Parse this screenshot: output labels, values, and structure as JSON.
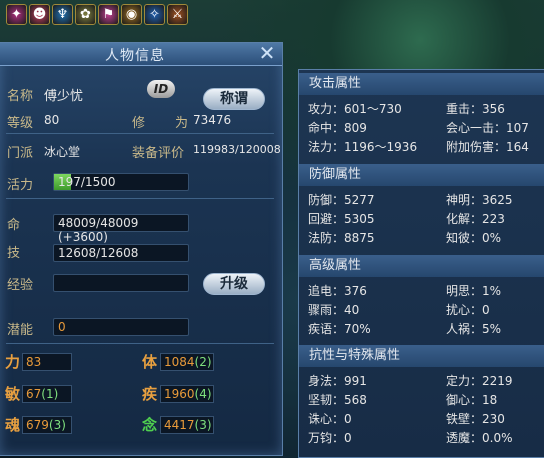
{
  "buffs": [
    {
      "icon": "buff-icon-1",
      "glyph": "✦",
      "color": "#b03080"
    },
    {
      "icon": "buff-icon-2",
      "glyph": "☻",
      "color": "#c84060"
    },
    {
      "icon": "buff-icon-3",
      "glyph": "♆",
      "color": "#2070b0"
    },
    {
      "icon": "buff-icon-4",
      "glyph": "✿",
      "color": "#808040"
    },
    {
      "icon": "buff-icon-5",
      "glyph": "⚑",
      "color": "#c04090"
    },
    {
      "icon": "buff-icon-6",
      "glyph": "◉",
      "color": "#a07020"
    },
    {
      "icon": "buff-icon-7",
      "glyph": "✧",
      "color": "#2060b0"
    },
    {
      "icon": "buff-icon-8",
      "glyph": "⚔",
      "color": "#a05020"
    }
  ],
  "left": {
    "title": "人物信息",
    "name_label": "名称",
    "name": "傅少忧",
    "id_button": "ID",
    "title_button": "称谓",
    "level_label": "等级",
    "level": "80",
    "cult_label1": "修",
    "cult_label2": "为",
    "cultivation": "73476",
    "sect_label": "门派",
    "sect": "冰心堂",
    "equip_label": "装备评价",
    "equip_score": "119983/120008",
    "vitality_label": "活力",
    "vitality": "197/1500",
    "vitality_fill": 0.13,
    "hp_label": "命",
    "hp": "48009/48009 (+3600)",
    "skill_label": "技",
    "skill": "12608/12608",
    "exp_label": "经验",
    "exp": "",
    "levelup_button": "升级",
    "potential_label": "潜能",
    "potential": "0",
    "stats": {
      "li_label": "力",
      "li": "83",
      "li_bonus": "",
      "ti_label": "体",
      "ti": "1084",
      "ti_bonus": "(2)",
      "min_label": "敏",
      "min": "67",
      "min_bonus": "(1)",
      "ji_label": "疾",
      "ji": "1960",
      "ji_bonus": "(4)",
      "hun_label": "魂",
      "hun": "679",
      "hun_bonus": "(3)",
      "nian_label": "念",
      "nian": "4417",
      "nian_bonus": "(3)"
    }
  },
  "right": {
    "attack_title": "攻击属性",
    "attack": [
      [
        "攻力：601～730",
        "重击：356"
      ],
      [
        "命中：809",
        "会心一击：107"
      ],
      [
        "法力：1196～1936",
        "附加伤害：164"
      ]
    ],
    "defense_title": "防御属性",
    "defense": [
      [
        "防御：5277",
        "神明：3625"
      ],
      [
        "回避：5305",
        "化解：223"
      ],
      [
        "法防：8875",
        "知彼：0%"
      ]
    ],
    "advanced_title": "高级属性",
    "advanced": [
      [
        "追电：376",
        "明思：1%"
      ],
      [
        "骤雨：40",
        "扰心：0"
      ],
      [
        "疾语：70%",
        "人祸：5%"
      ]
    ],
    "special_title": "抗性与特殊属性",
    "special": [
      [
        "身法：991",
        "定力：2219"
      ],
      [
        "坚韧：568",
        "御心：18"
      ],
      [
        "诛心：0",
        "铁壁：230"
      ],
      [
        "万钧：0",
        "透魔：0.0%"
      ]
    ]
  }
}
